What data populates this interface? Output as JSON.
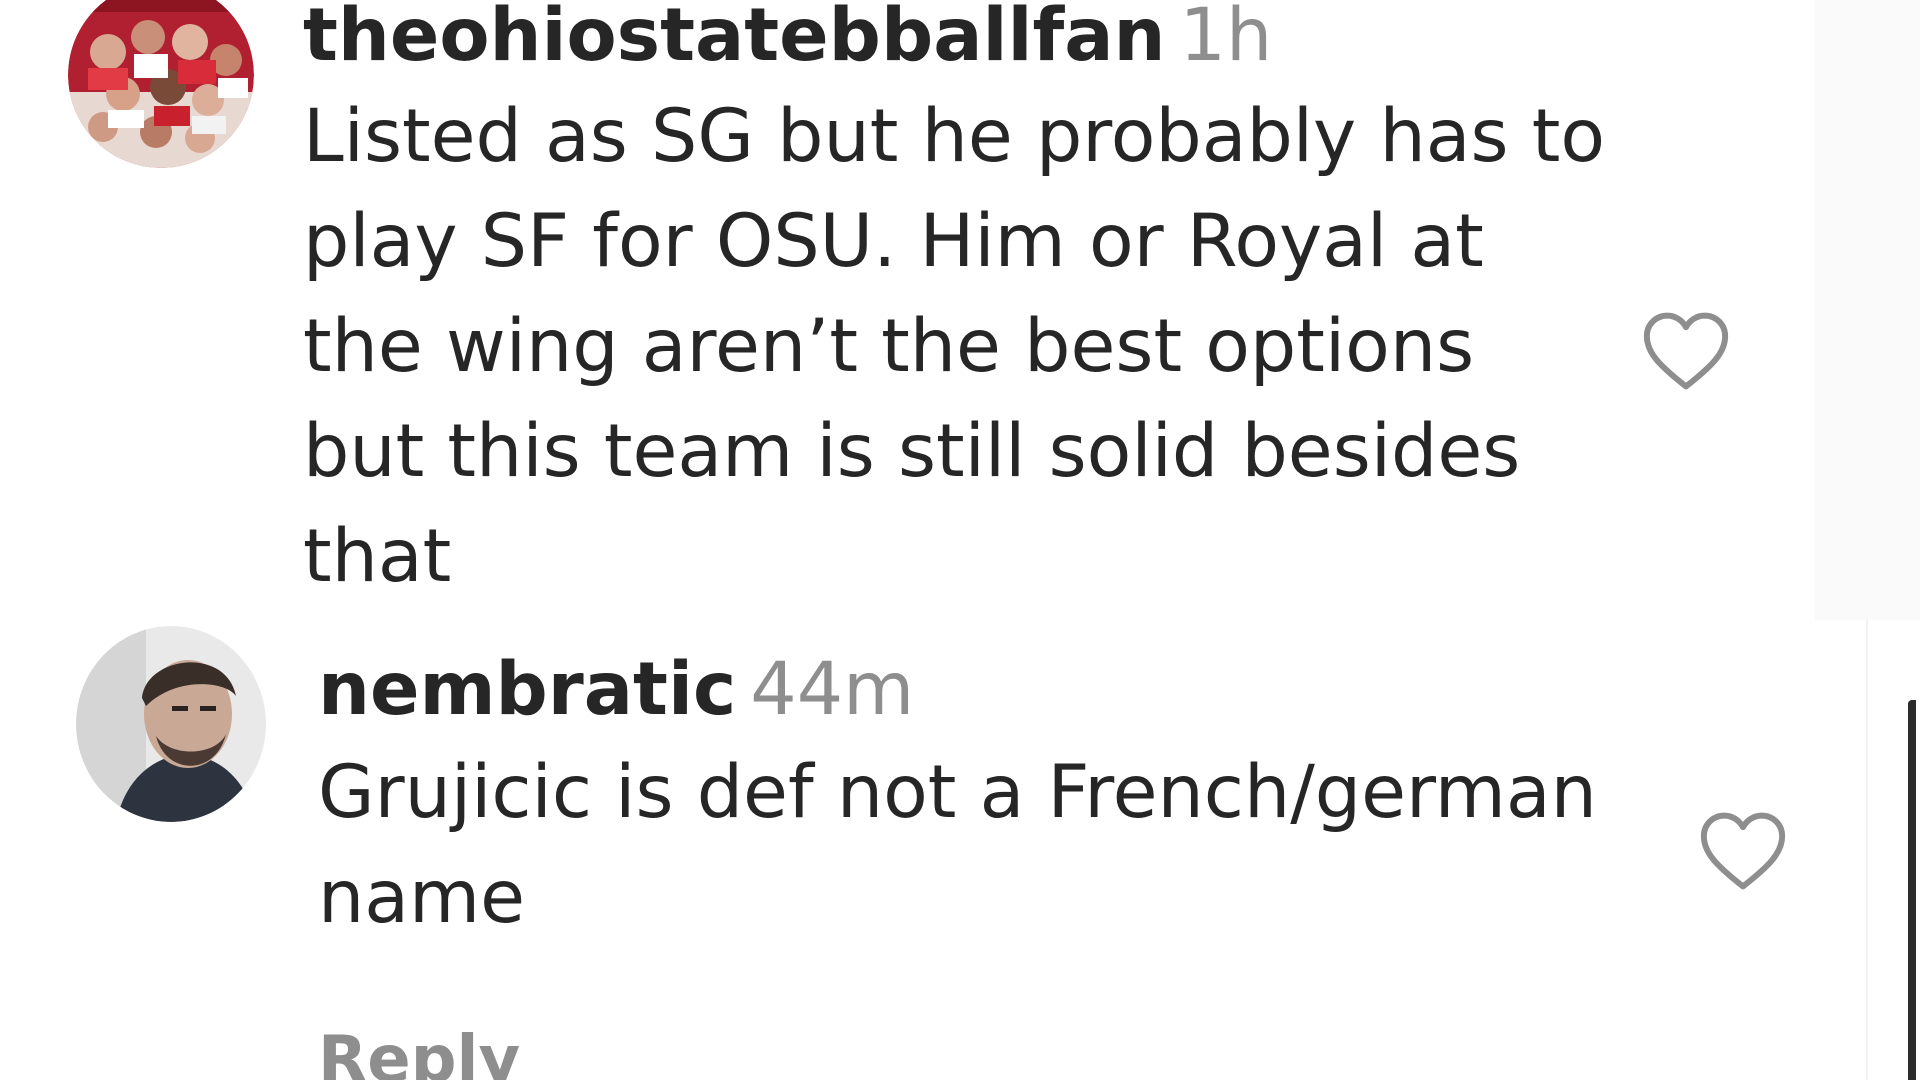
{
  "comments": [
    {
      "username": "theohiostatebballfan",
      "time": "1h",
      "lines": [
        "Listed as SG but he probably has to",
        "play SF for OSU. Him or Royal at",
        "the wing aren’t the best options",
        "but this team is still solid besides",
        "that"
      ],
      "avatar_icon": "group-photo-avatar",
      "like_icon": "heart-outline-icon"
    },
    {
      "username": "nembratic",
      "time": "44m",
      "lines": [
        "Grujicic is def not a French/german",
        "name"
      ],
      "avatar_icon": "person-photo-avatar",
      "like_icon": "heart-outline-icon"
    }
  ],
  "actions": {
    "reply_label": "Reply"
  },
  "colors": {
    "text": "#262626",
    "muted": "#8e8e8e",
    "background": "#ffffff",
    "avatar1_primary": "#c8283a",
    "avatar2_primary": "#6b6b6b"
  }
}
